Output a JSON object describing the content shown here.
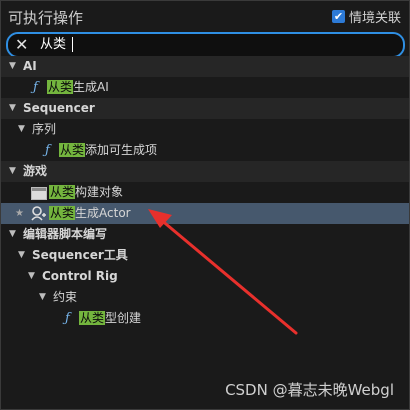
{
  "title": "可执行操作",
  "context_toggle": {
    "label": "情境关联",
    "checked": true,
    "check_glyph": "✔"
  },
  "search": {
    "value": "从类",
    "clear_glyph": "✕"
  },
  "tree": {
    "ai": {
      "category": "AI",
      "item_highlight": "从类",
      "item_rest": "生成AI"
    },
    "sequencer": {
      "category": "Sequencer",
      "sub": "序列",
      "item_highlight": "从类",
      "item_rest": "添加可生成项"
    },
    "game": {
      "category": "游戏",
      "item1_highlight": "从类",
      "item1_rest": "构建对象",
      "item2_highlight": "从类",
      "item2_rest": "生成Actor"
    },
    "editor": {
      "category": "编辑器脚本编写",
      "sub1": "Sequencer工具",
      "sub2": "Control Rig",
      "sub3": "约束",
      "item_highlight": "从类",
      "item_rest": "型创建"
    }
  },
  "glyphs": {
    "expanded": "▼",
    "fn": "ƒ",
    "star": "★"
  },
  "icons": [
    "close-icon",
    "checkbox-icon",
    "function-icon",
    "object-icon",
    "star-icon",
    "actor-icon",
    "expand-arrow-icon"
  ],
  "colors": {
    "highlight": "#74b53e",
    "selection": "#46586d",
    "accent": "#2f8fe3",
    "arrow": "#e8302c"
  },
  "watermark": "CSDN @暮志未晚Webgl"
}
